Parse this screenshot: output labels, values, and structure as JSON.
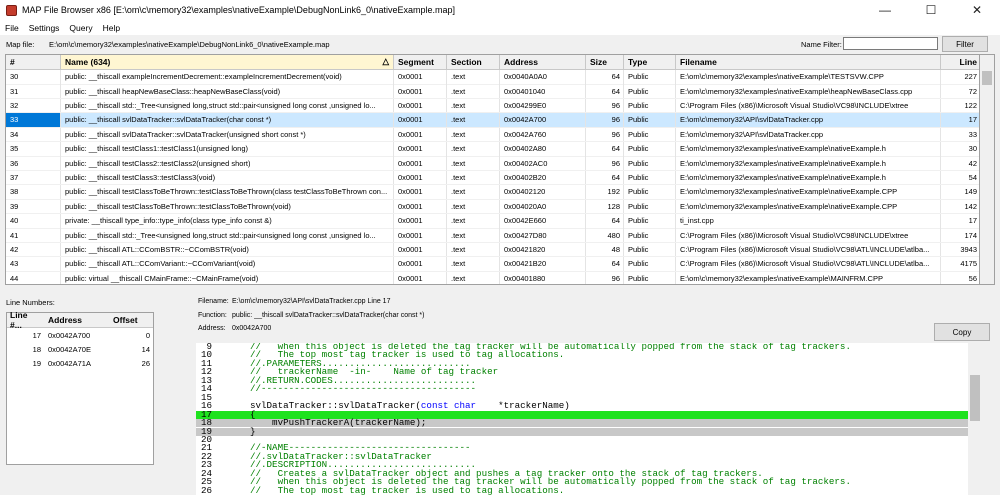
{
  "window": {
    "title": "MAP File Browser x86 [E:\\om\\c\\memory32\\examples\\nativeExample\\DebugNonLink6_0\\nativeExample.map]",
    "minimize": "—",
    "maximize": "☐",
    "close": "✕"
  },
  "menu": [
    "File",
    "Settings",
    "Query",
    "Help"
  ],
  "toolbar": {
    "mapfile_label": "Map file:",
    "mapfile_value": "E:\\om\\c\\memory32\\examples\\nativeExample\\DebugNonLink6_0\\nativeExample.map",
    "namefilter_label": "Name Filter:",
    "namefilter_value": "",
    "filter_button": "Filter"
  },
  "grid": {
    "headers": [
      "#",
      "Name (634)",
      "Segment",
      "Section",
      "Address",
      "Size",
      "Type",
      "Filename",
      "Line"
    ],
    "sort_glyph": "△",
    "rows": [
      [
        "30",
        "public: __thiscall exampleIncrementDecrement::exampleIncrementDecrement(void)",
        "0x0001",
        ".text",
        "0x0040A0A0",
        "64",
        "Public",
        "E:\\om\\c\\memory32\\examples\\nativeExample\\TESTSVW.CPP",
        "227"
      ],
      [
        "31",
        "public: __thiscall heapNewBaseClass::heapNewBaseClass(void)",
        "0x0001",
        ".text",
        "0x00401040",
        "64",
        "Public",
        "E:\\om\\c\\memory32\\examples\\nativeExample\\heapNewBaseClass.cpp",
        "72"
      ],
      [
        "32",
        "public: __thiscall std::_Tree<unsigned long,struct std::pair<unsigned long const ,unsigned lo...",
        "0x0001",
        ".text",
        "0x004299E0",
        "96",
        "Public",
        "C:\\Program Files (x86)\\Microsoft Visual Studio\\VC98\\INCLUDE\\xtree",
        "122"
      ],
      [
        "33",
        "public: __thiscall svlDataTracker::svlDataTracker(char const *)",
        "0x0001",
        ".text",
        "0x0042A700",
        "96",
        "Public",
        "E:\\om\\c\\memory32\\API\\svlDataTracker.cpp",
        "17"
      ],
      [
        "34",
        "public: __thiscall svlDataTracker::svlDataTracker(unsigned short const *)",
        "0x0001",
        ".text",
        "0x0042A760",
        "96",
        "Public",
        "E:\\om\\c\\memory32\\API\\svlDataTracker.cpp",
        "33"
      ],
      [
        "35",
        "public: __thiscall testClass1::testClass1(unsigned long)",
        "0x0001",
        ".text",
        "0x00402A80",
        "64",
        "Public",
        "E:\\om\\c\\memory32\\examples\\nativeExample\\nativeExample.h",
        "30"
      ],
      [
        "36",
        "public: __thiscall testClass2::testClass2(unsigned short)",
        "0x0001",
        ".text",
        "0x00402AC0",
        "96",
        "Public",
        "E:\\om\\c\\memory32\\examples\\nativeExample\\nativeExample.h",
        "42"
      ],
      [
        "37",
        "public: __thiscall testClass3::testClass3(void)",
        "0x0001",
        ".text",
        "0x00402B20",
        "64",
        "Public",
        "E:\\om\\c\\memory32\\examples\\nativeExample\\nativeExample.h",
        "54"
      ],
      [
        "38",
        "public: __thiscall testClassToBeThrown::testClassToBeThrown(class testClassToBeThrown con...",
        "0x0001",
        ".text",
        "0x00402120",
        "192",
        "Public",
        "E:\\om\\c\\memory32\\examples\\nativeExample\\nativeExample.CPP",
        "149"
      ],
      [
        "39",
        "public: __thiscall testClassToBeThrown::testClassToBeThrown(void)",
        "0x0001",
        ".text",
        "0x004020A0",
        "128",
        "Public",
        "E:\\om\\c\\memory32\\examples\\nativeExample\\nativeExample.CPP",
        "142"
      ],
      [
        "40",
        "private: __thiscall type_info::type_info(class type_info const &)",
        "0x0001",
        ".text",
        "0x0042E660",
        "64",
        "Public",
        "ti_inst.cpp",
        "17"
      ],
      [
        "41",
        "public: __thiscall std::_Tree<unsigned long,struct std::pair<unsigned long const ,unsigned lo...",
        "0x0001",
        ".text",
        "0x00427D80",
        "480",
        "Public",
        "C:\\Program Files (x86)\\Microsoft Visual Studio\\VC98\\INCLUDE\\xtree",
        "174"
      ],
      [
        "42",
        "public: __thiscall ATL::CComBSTR::~CComBSTR(void)",
        "0x0001",
        ".text",
        "0x00421820",
        "48",
        "Public",
        "C:\\Program Files (x86)\\Microsoft Visual Studio\\VC98\\ATL\\INCLUDE\\atlba...",
        "3943"
      ],
      [
        "43",
        "public: __thiscall ATL::CComVariant::~CComVariant(void)",
        "0x0001",
        ".text",
        "0x00421B20",
        "64",
        "Public",
        "C:\\Program Files (x86)\\Microsoft Visual Studio\\VC98\\ATL\\INCLUDE\\atlba...",
        "4175"
      ],
      [
        "44",
        "public: virtual __thiscall CMainFrame::~CMainFrame(void)",
        "0x0001",
        ".text",
        "0x00401880",
        "96",
        "Public",
        "E:\\om\\c\\memory32\\examples\\nativeExample\\MAINFRM.CPP",
        "56"
      ]
    ]
  },
  "line_numbers": {
    "label": "Line Numbers:",
    "headers": [
      "Line #...",
      "Address",
      "Offset"
    ],
    "rows": [
      [
        "17",
        "0x0042A700",
        "0"
      ],
      [
        "18",
        "0x0042A70E",
        "14"
      ],
      [
        "19",
        "0x0042A71A",
        "26"
      ]
    ]
  },
  "details": {
    "filename_label": "Filename:",
    "filename_value": "E:\\om\\c\\memory32\\API\\svlDataTracker.cpp Line 17",
    "function_label": "Function:",
    "function_value": "public: __thiscall svlDataTracker::svlDataTracker(char const *)",
    "address_label": "Address:",
    "address_value": "0x0042A700",
    "copy_button": "Copy"
  },
  "code": [
    {
      "n": "9",
      "t": "//   when this object is deleted the tag tracker will be automatically popped from the stack of tag trackers.",
      "k": "cm"
    },
    {
      "n": "10",
      "t": "//   The top most tag tracker is used to tag allocations.",
      "k": "cm"
    },
    {
      "n": "11",
      "t": "//.PARAMETERS...........................",
      "k": "cm"
    },
    {
      "n": "12",
      "t": "//   trackerName  -in-    Name of tag tracker",
      "k": "cm"
    },
    {
      "n": "13",
      "t": "//.RETURN.CODES..........................",
      "k": "cm"
    },
    {
      "n": "14",
      "t": "//---------------------------------------",
      "k": "cm"
    },
    {
      "n": "15",
      "t": "",
      "k": ""
    },
    {
      "n": "16",
      "t": "svlDataTracker::svlDataTracker(const char    *trackerName)",
      "k": "fn"
    },
    {
      "n": "17",
      "t": "{",
      "k": "green"
    },
    {
      "n": "18",
      "t": "    mvPushTrackerA(trackerName);",
      "k": "grey"
    },
    {
      "n": "19",
      "t": "}",
      "k": "grey"
    },
    {
      "n": "20",
      "t": "",
      "k": ""
    },
    {
      "n": "21",
      "t": "//-NAME---------------------------------",
      "k": "cm"
    },
    {
      "n": "22",
      "t": "//.svlDataTracker::svlDataTracker",
      "k": "cm"
    },
    {
      "n": "23",
      "t": "//.DESCRIPTION...........................",
      "k": "cm"
    },
    {
      "n": "24",
      "t": "//   Creates a svlDataTracker object and pushes a tag tracker onto the stack of tag trackers.",
      "k": "cm"
    },
    {
      "n": "25",
      "t": "//   when this object is deleted the tag tracker will be automatically popped from the stack of tag trackers.",
      "k": "cm"
    },
    {
      "n": "26",
      "t": "//   The top most tag tracker is used to tag allocations.",
      "k": "cm"
    }
  ]
}
